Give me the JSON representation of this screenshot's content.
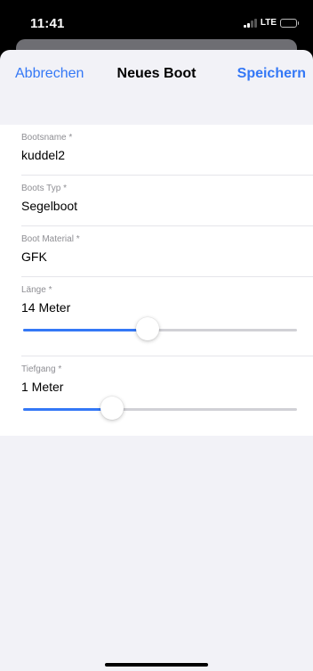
{
  "status_bar": {
    "time": "11:41",
    "network": "LTE",
    "signal_icon": "signal-bars-icon",
    "battery_icon": "battery-icon"
  },
  "nav": {
    "cancel_label": "Abbrechen",
    "title": "Neues Boot",
    "save_label": "Speichern"
  },
  "colors": {
    "accent": "#3478f6",
    "background": "#f2f2f7",
    "label": "#8e8e93",
    "track": "#d1d1d6"
  },
  "form": {
    "boat_name": {
      "label": "Bootsname *",
      "value": "kuddel2"
    },
    "boat_type": {
      "label": "Boots Typ *",
      "value": "Segelboot"
    },
    "boat_material": {
      "label": "Boot Material *",
      "value": "GFK"
    },
    "length": {
      "label": "Länge *",
      "value_text": "14 Meter",
      "slider_fraction": 0.455
    },
    "draft": {
      "label": "Tiefgang *",
      "value_text": "1 Meter",
      "slider_fraction": 0.325
    }
  }
}
